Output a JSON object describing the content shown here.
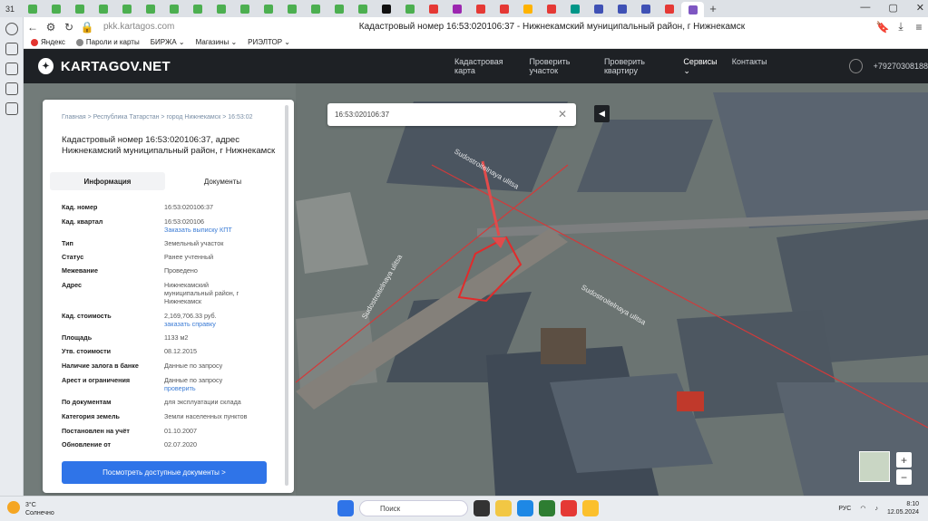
{
  "browser": {
    "tab_count_label": "31",
    "url": "pkk.kartagos.com",
    "page_title": "Кадастровый номер 16:53:020106:37 - Нижнекамский муниципальный район, г Нижнекамск",
    "bookmarks": [
      "Яндекс",
      "Пароли и карты",
      "БИРЖА",
      "Магазины",
      "РИЭЛТОР"
    ]
  },
  "site": {
    "logo": "KARTAGOV.NET",
    "nav": [
      "Кадастровая карта",
      "Проверить участок",
      "Проверить квартиру",
      "Сервисы",
      "Контакты"
    ],
    "phone": "+79270308188"
  },
  "panel": {
    "breadcrumbs": "Главная  >  Республика Татарстан  >  город Нижнекамск  >  16:53:02",
    "title": "Кадастровый номер 16:53:020106:37, адрес Нижнекамский муниципальный район, г Нижнекамск",
    "tabs": [
      "Информация",
      "Документы"
    ],
    "rows": [
      {
        "key": "Кад. номер",
        "value": "16:53:020106:37"
      },
      {
        "key": "Кад. квартал",
        "value": "16:53:020106",
        "link": "Заказать выписку КПТ"
      },
      {
        "key": "Тип",
        "value": "Земельный участок"
      },
      {
        "key": "Статус",
        "value": "Ранее учтенный"
      },
      {
        "key": "Межевание",
        "value": "Проведено"
      },
      {
        "key": "Адрес",
        "value": "Нижнекамский муниципальный район, г Нижнекамск"
      },
      {
        "key": "Кад. стоимость",
        "value": "2,169,706.33 руб.",
        "link": "заказать справку"
      },
      {
        "key": "Площадь",
        "value": "1133 м2"
      },
      {
        "key": "Утв. стоимости",
        "value": "08.12.2015"
      },
      {
        "key": "Наличие залога в банке",
        "value": "Данные по запросу"
      },
      {
        "key": "Арест и ограничения",
        "value": "Данные по запросу",
        "link": "проверить"
      },
      {
        "key": "По документам",
        "value": "для эксплуатации склада"
      },
      {
        "key": "Категория земель",
        "value": "Земли населенных пунктов"
      },
      {
        "key": "Постановлен на учёт",
        "value": "01.10.2007"
      },
      {
        "key": "Обновление от",
        "value": "02.07.2020"
      }
    ],
    "cta": "Посмотреть доступные документы >"
  },
  "map": {
    "search_value": "16:53:020106:37",
    "street_labels": [
      "Sudostroitelnaya ulitsa",
      "Sudostroitelnaya ulitsa",
      "Sudostroitelnaya ulitsa"
    ]
  },
  "taskbar": {
    "temp": "3°C",
    "weather": "Солнечно",
    "search": "Поиск",
    "lang": "РУС",
    "time": "8:10",
    "date": "12.05.2024"
  }
}
